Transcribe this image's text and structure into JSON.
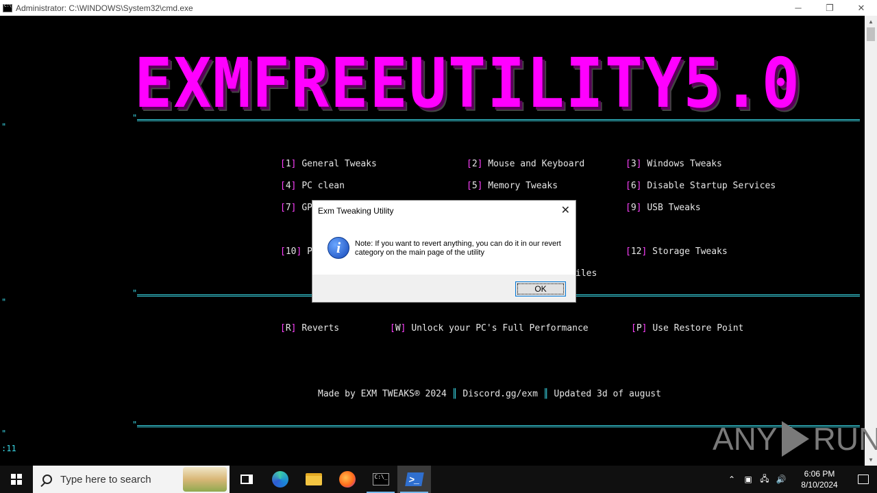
{
  "window": {
    "title": "Administrator: C:\\WINDOWS\\System32\\cmd.exe",
    "minimize": "─",
    "restore": "❐",
    "close": "✕"
  },
  "console": {
    "banner": "EXMFREEUTILITY5.0",
    "tick": "\"",
    "menu": [
      {
        "key": "1",
        "label": "General Tweaks"
      },
      {
        "key": "2",
        "label": "Mouse and Keyboard"
      },
      {
        "key": "3",
        "label": "Windows Tweaks"
      },
      {
        "key": "4",
        "label": "PC clean"
      },
      {
        "key": "5",
        "label": "Memory Tweaks"
      },
      {
        "key": "6",
        "label": "Disable Startup Services"
      },
      {
        "key": "7",
        "label": "GP"
      },
      {
        "key": "9",
        "label": "USB Tweaks"
      },
      {
        "key": "10",
        "label": "P"
      },
      {
        "key": "12",
        "label": "Storage Tweaks"
      }
    ],
    "partial_text": "iles",
    "actions": [
      {
        "key": "R",
        "label": "Reverts"
      },
      {
        "key": "W",
        "label": "Unlock your PC's Full Performance"
      },
      {
        "key": "P",
        "label": "Use Restore Point"
      }
    ],
    "footer": {
      "made_by": "Made by EXM TWEAKS® 2024",
      "discord": "Discord.gg/exm",
      "updated": "Updated 3d of august",
      "sep": "║"
    },
    "left_line": ":11"
  },
  "dialog": {
    "title": "Exm Tweaking Utility",
    "message": "Note: If you want to revert anything, you can do it in our revert category on the main page of the utility",
    "ok": "OK",
    "close": "✕",
    "icon": "i"
  },
  "watermark": {
    "left": "ANY",
    "right": "RUN"
  },
  "taskbar": {
    "search_placeholder": "Type here to search",
    "time": "6:06 PM",
    "date": "8/10/2024"
  }
}
